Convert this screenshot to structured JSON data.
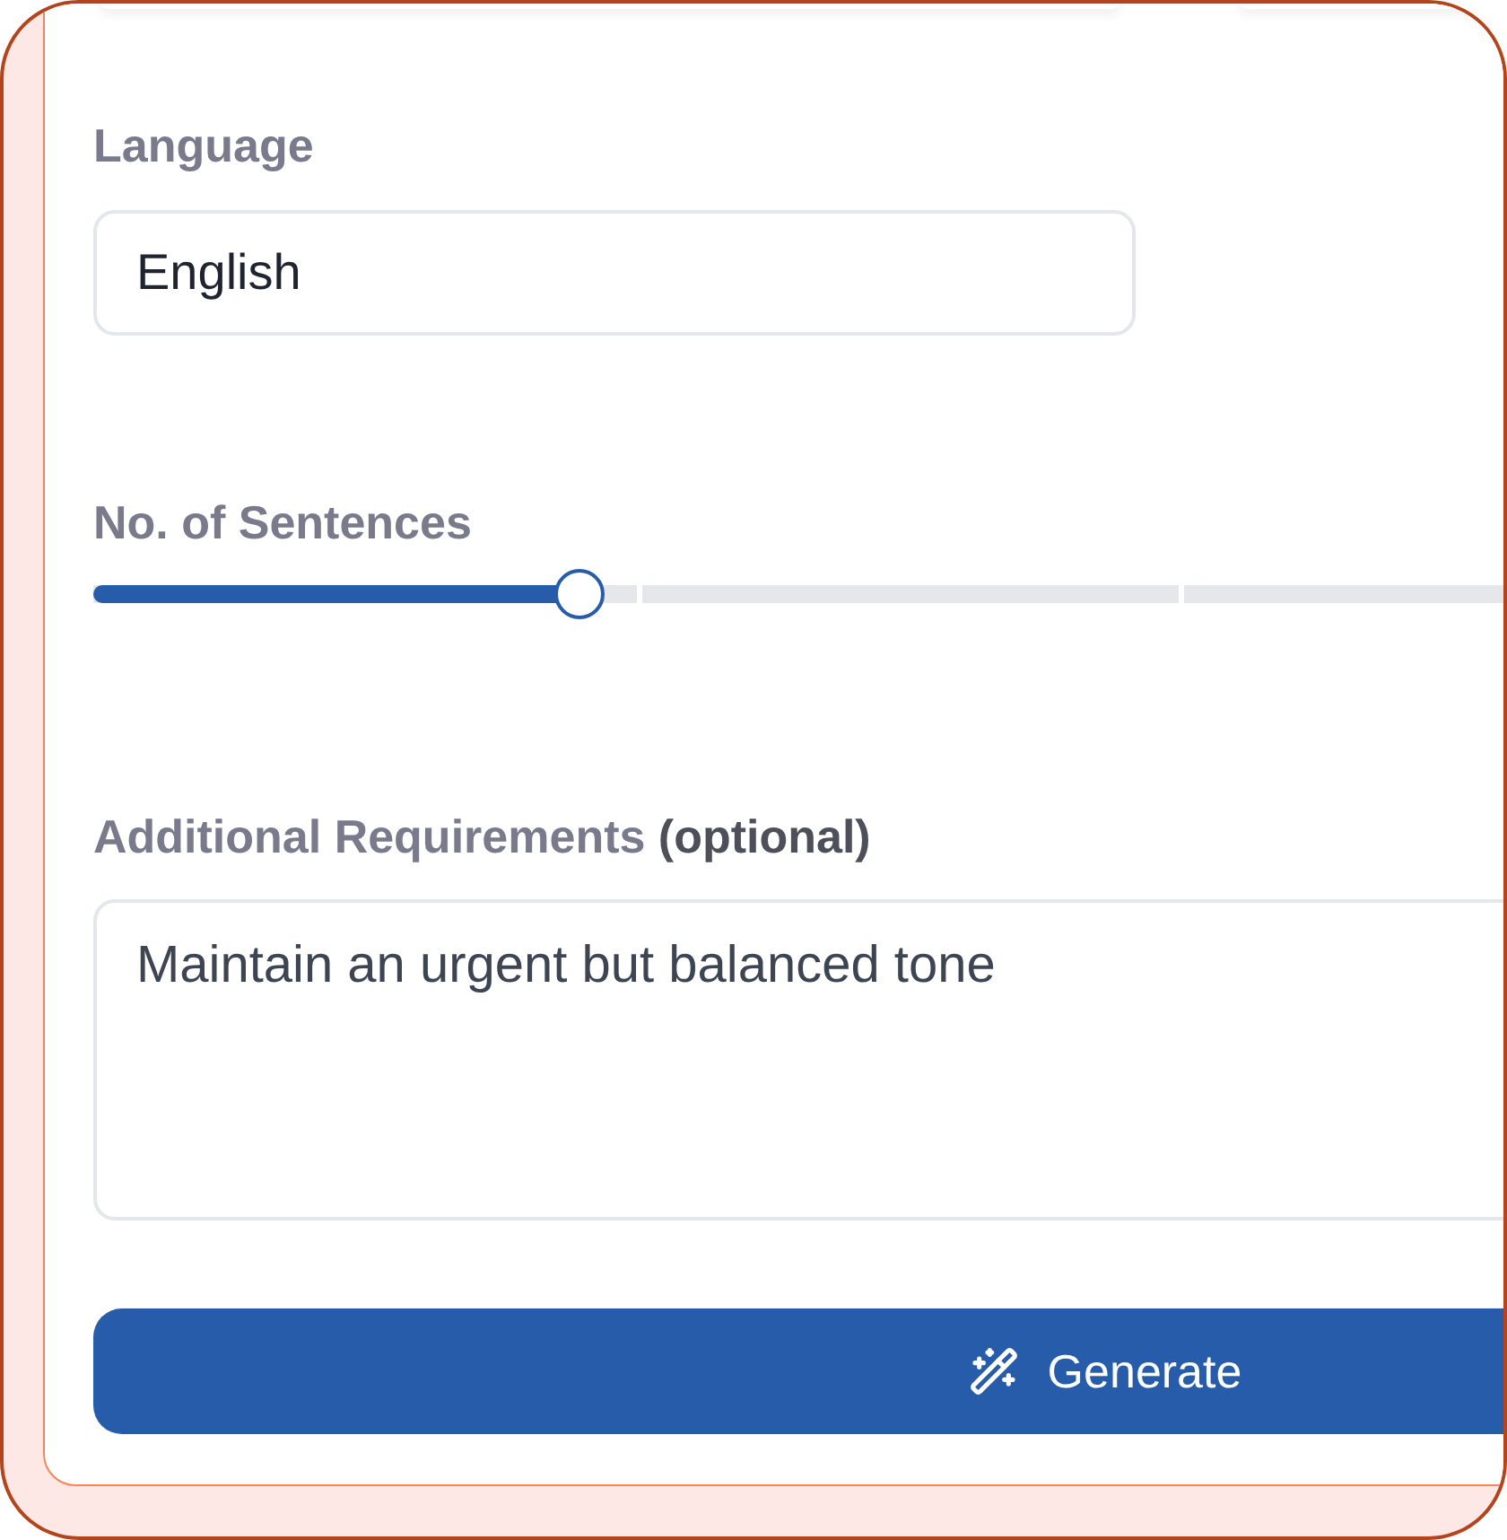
{
  "language": {
    "label": "Language",
    "value": "English"
  },
  "sentences": {
    "label": "No. of Sentences",
    "level": 0.24
  },
  "requirements": {
    "label": "Additional Requirements **(optional)**",
    "value": "Maintain an urgent but balanced tone"
  },
  "generate_button": {
    "label": "Generate"
  }
}
